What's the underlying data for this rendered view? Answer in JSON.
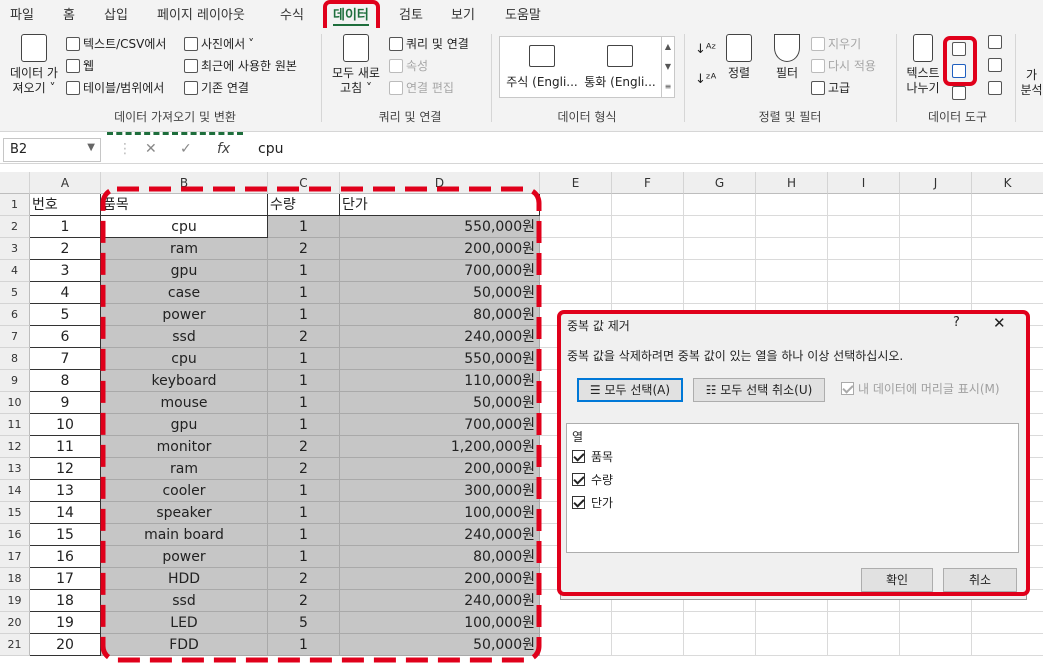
{
  "tabs": [
    "파일",
    "홈",
    "삽입",
    "페이지 레이아웃",
    "수식",
    "데이터",
    "검토",
    "보기",
    "도움말"
  ],
  "active_tab": "데이터",
  "ribbon": {
    "get_data_1": "데이터 가",
    "get_data_2": "져오기",
    "text_csv": "텍스트/CSV에서",
    "web": "웹",
    "table_range": "테이블/범위에서",
    "from_picture": "사진에서",
    "recent_sources": "최근에 사용한 원본",
    "existing_conn": "기존 연결",
    "group_get": "데이터 가져오기 및 변환",
    "refresh_all_1": "모두 새로",
    "refresh_all_2": "고침",
    "queries_conn": "쿼리 및 연결",
    "properties": "속성",
    "edit_links": "연결 편집",
    "group_queries": "쿼리 및 연결",
    "stocks": "주식 (Engli...",
    "currency": "통화 (Engli...",
    "group_types": "데이터 형식",
    "sort": "정렬",
    "filter": "필터",
    "clear": "지우기",
    "reapply": "다시 적용",
    "advanced": "고급",
    "group_sort": "정렬 및 필터",
    "text_to_col_1": "텍스트",
    "text_to_col_2": "나누기",
    "group_tools": "데이터 도구",
    "analysis_1": "가",
    "analysis_2": "분석"
  },
  "formula_bar": {
    "name_box": "B2",
    "fx": "fx",
    "value": "cpu"
  },
  "columns": [
    "A",
    "B",
    "C",
    "D",
    "E",
    "F",
    "G",
    "H",
    "I",
    "J",
    "K"
  ],
  "rows": [
    {
      "n": "1",
      "a": "번호",
      "b": "품목",
      "c": "수량",
      "d": "단가"
    },
    {
      "n": "2",
      "a": "1",
      "b": "cpu",
      "c": "1",
      "d": "550,000원"
    },
    {
      "n": "3",
      "a": "2",
      "b": "ram",
      "c": "2",
      "d": "200,000원"
    },
    {
      "n": "4",
      "a": "3",
      "b": "gpu",
      "c": "1",
      "d": "700,000원"
    },
    {
      "n": "5",
      "a": "4",
      "b": "case",
      "c": "1",
      "d": "50,000원"
    },
    {
      "n": "6",
      "a": "5",
      "b": "power",
      "c": "1",
      "d": "80,000원"
    },
    {
      "n": "7",
      "a": "6",
      "b": "ssd",
      "c": "2",
      "d": "240,000원"
    },
    {
      "n": "8",
      "a": "7",
      "b": "cpu",
      "c": "1",
      "d": "550,000원"
    },
    {
      "n": "9",
      "a": "8",
      "b": "keyboard",
      "c": "1",
      "d": "110,000원"
    },
    {
      "n": "10",
      "a": "9",
      "b": "mouse",
      "c": "1",
      "d": "50,000원"
    },
    {
      "n": "11",
      "a": "10",
      "b": "gpu",
      "c": "1",
      "d": "700,000원"
    },
    {
      "n": "12",
      "a": "11",
      "b": "monitor",
      "c": "2",
      "d": "1,200,000원"
    },
    {
      "n": "13",
      "a": "12",
      "b": "ram",
      "c": "2",
      "d": "200,000원"
    },
    {
      "n": "14",
      "a": "13",
      "b": "cooler",
      "c": "1",
      "d": "300,000원"
    },
    {
      "n": "15",
      "a": "14",
      "b": "speaker",
      "c": "1",
      "d": "100,000원"
    },
    {
      "n": "16",
      "a": "15",
      "b": "main board",
      "c": "1",
      "d": "240,000원"
    },
    {
      "n": "17",
      "a": "16",
      "b": "power",
      "c": "1",
      "d": "80,000원"
    },
    {
      "n": "18",
      "a": "17",
      "b": "HDD",
      "c": "2",
      "d": "200,000원"
    },
    {
      "n": "19",
      "a": "18",
      "b": "ssd",
      "c": "2",
      "d": "240,000원"
    },
    {
      "n": "20",
      "a": "19",
      "b": "LED",
      "c": "5",
      "d": "100,000원"
    },
    {
      "n": "21",
      "a": "20",
      "b": "FDD",
      "c": "1",
      "d": "50,000원"
    }
  ],
  "dialog": {
    "title": "중복 값 제거",
    "help": "?",
    "close": "✕",
    "description": "중복 값을 삭제하려면 중복 값이 있는 열을 하나 이상 선택하십시오.",
    "select_all": "모두 선택(A)",
    "unselect_all": "모두 선택 취소(U)",
    "has_headers": "내 데이터에 머리글 표시(M)",
    "list_header": "열",
    "columns": [
      "품목",
      "수량",
      "단가"
    ],
    "ok": "확인",
    "cancel": "취소"
  },
  "colors": {
    "accent": "#1e6e3c",
    "highlight": "#e0001b",
    "selection": "#c6c6c6"
  }
}
